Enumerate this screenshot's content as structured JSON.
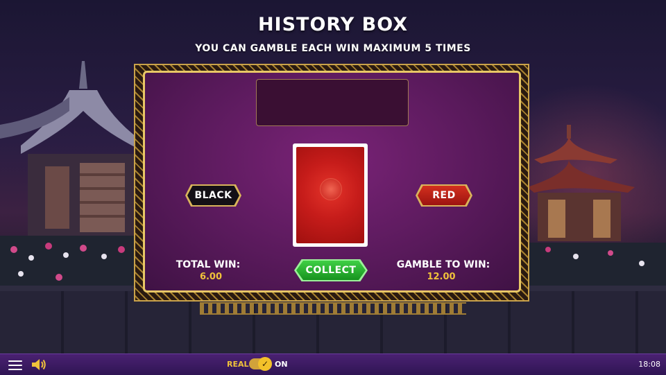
{
  "header": {
    "title": "HISTORY BOX",
    "subtitle": "YOU CAN GAMBLE EACH WIN MAXIMUM 5 TIMES"
  },
  "gamble": {
    "history_cards": [],
    "card": {
      "state": "face-down",
      "back_color": "#c61c1a"
    },
    "black_label": "BLACK",
    "red_label": "RED",
    "collect_label": "COLLECT",
    "total_win_label": "TOTAL WIN:",
    "total_win_value": "6.00",
    "gamble_to_win_label": "GAMBLE TO WIN:",
    "gamble_to_win_value": "12.00"
  },
  "bottom_bar": {
    "menu_icon": "hamburger-menu-icon",
    "sound_icon": "speaker-icon",
    "real_label": "REAL",
    "toggle_on": true,
    "on_label": "ON",
    "clock": "18:08"
  },
  "colors": {
    "panel": "#5a1a5c",
    "gold": "#e8c766",
    "value_gold": "#f0c23a",
    "collect_green": "#3fcf45",
    "red_button": "#d3301e",
    "bottom_bar": "#3c1a63"
  }
}
